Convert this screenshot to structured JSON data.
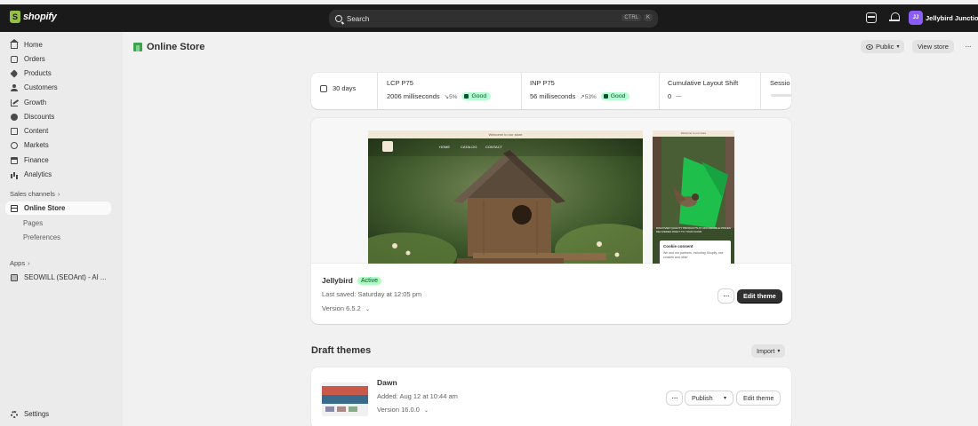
{
  "topbar": {
    "logo_text": "shopify",
    "search_placeholder": "Search",
    "shortcut_ctrl": "CTRL",
    "shortcut_k": "K",
    "avatar_initials": "JJ",
    "store_name": "Jellybird Junction",
    "icons": [
      "storefront-icon",
      "bell-icon"
    ]
  },
  "sidebar": {
    "items": [
      {
        "label": "Home",
        "icon": "home-icon"
      },
      {
        "label": "Orders",
        "icon": "orders-icon"
      },
      {
        "label": "Products",
        "icon": "tag-icon"
      },
      {
        "label": "Customers",
        "icon": "person-icon"
      },
      {
        "label": "Growth",
        "icon": "growth-icon"
      },
      {
        "label": "Discounts",
        "icon": "discount-icon"
      },
      {
        "label": "Content",
        "icon": "content-icon"
      },
      {
        "label": "Markets",
        "icon": "globe-icon"
      },
      {
        "label": "Finance",
        "icon": "bank-icon"
      },
      {
        "label": "Analytics",
        "icon": "bar-chart-icon"
      }
    ],
    "sales_channels_label": "Sales channels",
    "online_store_label": "Online Store",
    "sub_items": [
      "Pages",
      "Preferences"
    ],
    "apps_label": "Apps",
    "app_item": "SEOWILL (SEOAnt) - AI ...",
    "settings_label": "Settings"
  },
  "header": {
    "title": "Online Store",
    "visibility_label": "Public",
    "view_store_label": "View store"
  },
  "metrics": {
    "range_label": "30 days",
    "items": [
      {
        "label": "LCP P75",
        "value": "2006 milliseconds",
        "delta": "↘5%",
        "status": "Good"
      },
      {
        "label": "INP P75",
        "value": "56 milliseconds",
        "delta": "↗53%",
        "status": "Good"
      },
      {
        "label": "Cumulative Layout Shift",
        "value": "0",
        "delta": "—"
      },
      {
        "label": "Sessio"
      }
    ]
  },
  "current_theme": {
    "name": "Jellybird",
    "status": "Active",
    "last_saved": "Last saved: Saturday at 12:05 pm",
    "version": "Version 6.5.2",
    "edit_label": "Edit theme",
    "preview": {
      "announcement": "Welcome to our store",
      "nav": [
        "HOME",
        "CATALOG",
        "CONTACT"
      ],
      "mobile_announcement": "Welcome to our store",
      "mobile_text": "DISCOVER QUALITY PRODUCTS AT AFFORDABLE PRICES DELIVERED RIGHT TO YOUR DOOR",
      "cookie_title": "Cookie consent",
      "cookie_text": "We and our partners, including Shopify, use cookies and other"
    }
  },
  "drafts": {
    "section_title": "Draft themes",
    "import_label": "Import",
    "theme": {
      "name": "Dawn",
      "added": "Added: Aug 12 at 10:44 am",
      "version": "Version 16.0.0",
      "publish_label": "Publish",
      "edit_label": "Edit theme"
    }
  },
  "colors": {
    "topbar": "#1a1a1a",
    "good_badge": "#b4fed2",
    "active_badge": "#affebf",
    "primary_button": "#303030",
    "avatar": "#8b5cf6"
  }
}
